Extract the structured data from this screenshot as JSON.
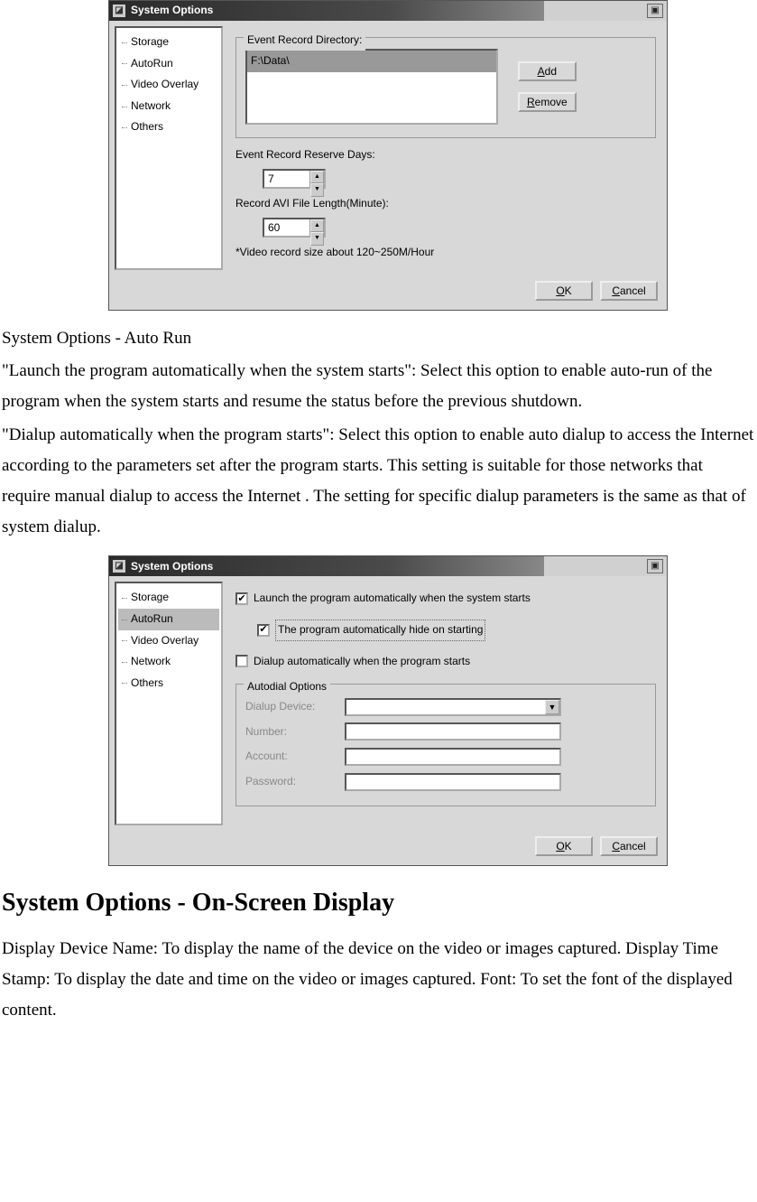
{
  "dialog1": {
    "title": "System Options",
    "tree": [
      "Storage",
      "AutoRun",
      "Video Overlay",
      "Network",
      "Others"
    ],
    "group_title": "Event Record Directory:",
    "dir_value": "F:\\Data\\",
    "add_btn_prefix": "A",
    "add_btn_rest": "dd",
    "remove_btn_prefix": "R",
    "remove_btn_rest": "emove",
    "reserve_label": "Event Record Reserve Days:",
    "reserve_value": "7",
    "avi_label": "Record AVI File Length(Minute):",
    "avi_value": "60",
    "note": "*Video record size about 120~250M/Hour",
    "ok_prefix": "O",
    "ok_rest": "K",
    "cancel_prefix": "C",
    "cancel_rest": "ancel"
  },
  "para1_heading": "System Options - Auto Run",
  "para1a": "\"Launch the program automatically when the system starts\": Select this option to enable auto-run of the program when the system starts and resume the status before the previous shutdown.",
  "para1b": "\"Dialup automatically when the program starts\": Select this option to enable auto dialup to access the Internet according to the parameters set after the program starts. This setting is suitable for those networks that require manual dialup to access the Internet . The setting for specific dialup parameters is the same as that of system dialup.",
  "dialog2": {
    "title": "System Options",
    "tree": [
      "Storage",
      "AutoRun",
      "Video Overlay",
      "Network",
      "Others"
    ],
    "selected_index": 1,
    "chk1": "Launch the program automatically when the system starts",
    "chk2": "The program automatically hide on starting",
    "chk3": "Dialup automatically when the program starts",
    "group_title": "Autodial Options",
    "f_device": "Dialup Device:",
    "f_number": "Number:",
    "f_account": "Account:",
    "f_password": "Password:",
    "ok_prefix": "O",
    "ok_rest": "K",
    "cancel_prefix": "C",
    "cancel_rest": "ancel"
  },
  "h2": "System Options - On-Screen Display",
  "para2": "Display Device Name: To display the name of the device on the video or images captured. Display Time Stamp: To display the date and time on the video or images captured. Font: To set the font of the displayed content."
}
